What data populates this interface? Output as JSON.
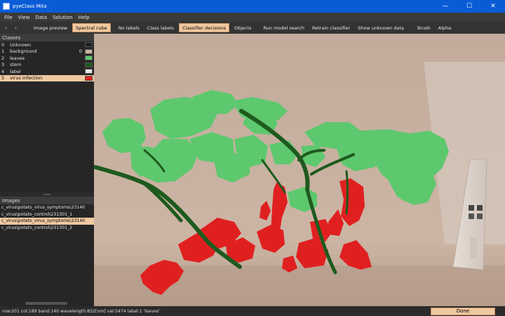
{
  "window": {
    "title": "pyeClass Mita",
    "minimize": "—",
    "maximize": "☐",
    "close": "✕"
  },
  "menu": [
    "File",
    "View",
    "Data",
    "Solution",
    "Help"
  ],
  "toolbar": {
    "back": "‹",
    "forward": "›",
    "buttons": [
      {
        "label": "Image preview",
        "active": false
      },
      {
        "label": "Spectral cube",
        "active": true
      },
      {
        "label": "No labels",
        "active": false
      },
      {
        "label": "Class labels",
        "active": false
      },
      {
        "label": "Classifier decisions",
        "active": true
      },
      {
        "label": "Objects",
        "active": false
      },
      {
        "label": "Run model search",
        "active": false
      },
      {
        "label": "Retrain classifier",
        "active": false
      },
      {
        "label": "Show unknown data",
        "active": false
      },
      {
        "label": "Brush",
        "active": false
      },
      {
        "label": "Alpha",
        "active": false
      }
    ]
  },
  "classes": {
    "header": "Classes",
    "items": [
      {
        "idx": "0",
        "name": "Unknown",
        "count": "",
        "color": "#1e1e1e"
      },
      {
        "idx": "1",
        "name": "background",
        "count": "0",
        "color": "#c8b4a4"
      },
      {
        "idx": "2",
        "name": "leaves",
        "count": "",
        "color": "#5ec86e"
      },
      {
        "idx": "3",
        "name": "stem",
        "count": "",
        "color": "#1e5a1e"
      },
      {
        "idx": "4",
        "name": "label",
        "count": "",
        "color": "#e8e8e8"
      },
      {
        "idx": "5",
        "name": "virus infection",
        "count": "",
        "color": "#e02020",
        "selected": true
      }
    ]
  },
  "images": {
    "header": "Images",
    "items": [
      {
        "name": "c_virus\\potato_virus_symptoms\\23140",
        "selected": false
      },
      {
        "name": "c_virus\\potato_control\\231301_1",
        "selected": false
      },
      {
        "name": "c_virus\\potato_virus_symptoms\\23140",
        "selected": true
      },
      {
        "name": "c_virus\\potato_control\\231301_2",
        "selected": false
      }
    ]
  },
  "status": {
    "text": "row:201 col:189 band:140 wavelength:832[nm] val:5474 label:1 'leaves'",
    "done": "Done"
  },
  "colors": {
    "leaves": "#5ec86e",
    "stem": "#1e5a1e",
    "virus": "#e02020",
    "background": "#c9b09f",
    "accent": "#f0c8a0"
  }
}
